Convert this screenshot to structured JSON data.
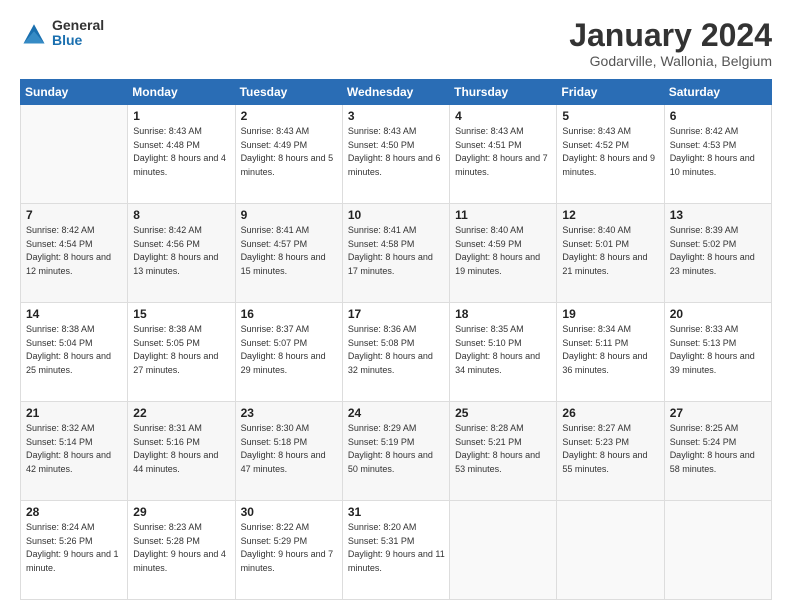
{
  "logo": {
    "general": "General",
    "blue": "Blue"
  },
  "header": {
    "month": "January 2024",
    "location": "Godarville, Wallonia, Belgium"
  },
  "weekdays": [
    "Sunday",
    "Monday",
    "Tuesday",
    "Wednesday",
    "Thursday",
    "Friday",
    "Saturday"
  ],
  "weeks": [
    [
      {
        "day": "",
        "sunrise": "",
        "sunset": "",
        "daylight": ""
      },
      {
        "day": "1",
        "sunrise": "Sunrise: 8:43 AM",
        "sunset": "Sunset: 4:48 PM",
        "daylight": "Daylight: 8 hours and 4 minutes."
      },
      {
        "day": "2",
        "sunrise": "Sunrise: 8:43 AM",
        "sunset": "Sunset: 4:49 PM",
        "daylight": "Daylight: 8 hours and 5 minutes."
      },
      {
        "day": "3",
        "sunrise": "Sunrise: 8:43 AM",
        "sunset": "Sunset: 4:50 PM",
        "daylight": "Daylight: 8 hours and 6 minutes."
      },
      {
        "day": "4",
        "sunrise": "Sunrise: 8:43 AM",
        "sunset": "Sunset: 4:51 PM",
        "daylight": "Daylight: 8 hours and 7 minutes."
      },
      {
        "day": "5",
        "sunrise": "Sunrise: 8:43 AM",
        "sunset": "Sunset: 4:52 PM",
        "daylight": "Daylight: 8 hours and 9 minutes."
      },
      {
        "day": "6",
        "sunrise": "Sunrise: 8:42 AM",
        "sunset": "Sunset: 4:53 PM",
        "daylight": "Daylight: 8 hours and 10 minutes."
      }
    ],
    [
      {
        "day": "7",
        "sunrise": "Sunrise: 8:42 AM",
        "sunset": "Sunset: 4:54 PM",
        "daylight": "Daylight: 8 hours and 12 minutes."
      },
      {
        "day": "8",
        "sunrise": "Sunrise: 8:42 AM",
        "sunset": "Sunset: 4:56 PM",
        "daylight": "Daylight: 8 hours and 13 minutes."
      },
      {
        "day": "9",
        "sunrise": "Sunrise: 8:41 AM",
        "sunset": "Sunset: 4:57 PM",
        "daylight": "Daylight: 8 hours and 15 minutes."
      },
      {
        "day": "10",
        "sunrise": "Sunrise: 8:41 AM",
        "sunset": "Sunset: 4:58 PM",
        "daylight": "Daylight: 8 hours and 17 minutes."
      },
      {
        "day": "11",
        "sunrise": "Sunrise: 8:40 AM",
        "sunset": "Sunset: 4:59 PM",
        "daylight": "Daylight: 8 hours and 19 minutes."
      },
      {
        "day": "12",
        "sunrise": "Sunrise: 8:40 AM",
        "sunset": "Sunset: 5:01 PM",
        "daylight": "Daylight: 8 hours and 21 minutes."
      },
      {
        "day": "13",
        "sunrise": "Sunrise: 8:39 AM",
        "sunset": "Sunset: 5:02 PM",
        "daylight": "Daylight: 8 hours and 23 minutes."
      }
    ],
    [
      {
        "day": "14",
        "sunrise": "Sunrise: 8:38 AM",
        "sunset": "Sunset: 5:04 PM",
        "daylight": "Daylight: 8 hours and 25 minutes."
      },
      {
        "day": "15",
        "sunrise": "Sunrise: 8:38 AM",
        "sunset": "Sunset: 5:05 PM",
        "daylight": "Daylight: 8 hours and 27 minutes."
      },
      {
        "day": "16",
        "sunrise": "Sunrise: 8:37 AM",
        "sunset": "Sunset: 5:07 PM",
        "daylight": "Daylight: 8 hours and 29 minutes."
      },
      {
        "day": "17",
        "sunrise": "Sunrise: 8:36 AM",
        "sunset": "Sunset: 5:08 PM",
        "daylight": "Daylight: 8 hours and 32 minutes."
      },
      {
        "day": "18",
        "sunrise": "Sunrise: 8:35 AM",
        "sunset": "Sunset: 5:10 PM",
        "daylight": "Daylight: 8 hours and 34 minutes."
      },
      {
        "day": "19",
        "sunrise": "Sunrise: 8:34 AM",
        "sunset": "Sunset: 5:11 PM",
        "daylight": "Daylight: 8 hours and 36 minutes."
      },
      {
        "day": "20",
        "sunrise": "Sunrise: 8:33 AM",
        "sunset": "Sunset: 5:13 PM",
        "daylight": "Daylight: 8 hours and 39 minutes."
      }
    ],
    [
      {
        "day": "21",
        "sunrise": "Sunrise: 8:32 AM",
        "sunset": "Sunset: 5:14 PM",
        "daylight": "Daylight: 8 hours and 42 minutes."
      },
      {
        "day": "22",
        "sunrise": "Sunrise: 8:31 AM",
        "sunset": "Sunset: 5:16 PM",
        "daylight": "Daylight: 8 hours and 44 minutes."
      },
      {
        "day": "23",
        "sunrise": "Sunrise: 8:30 AM",
        "sunset": "Sunset: 5:18 PM",
        "daylight": "Daylight: 8 hours and 47 minutes."
      },
      {
        "day": "24",
        "sunrise": "Sunrise: 8:29 AM",
        "sunset": "Sunset: 5:19 PM",
        "daylight": "Daylight: 8 hours and 50 minutes."
      },
      {
        "day": "25",
        "sunrise": "Sunrise: 8:28 AM",
        "sunset": "Sunset: 5:21 PM",
        "daylight": "Daylight: 8 hours and 53 minutes."
      },
      {
        "day": "26",
        "sunrise": "Sunrise: 8:27 AM",
        "sunset": "Sunset: 5:23 PM",
        "daylight": "Daylight: 8 hours and 55 minutes."
      },
      {
        "day": "27",
        "sunrise": "Sunrise: 8:25 AM",
        "sunset": "Sunset: 5:24 PM",
        "daylight": "Daylight: 8 hours and 58 minutes."
      }
    ],
    [
      {
        "day": "28",
        "sunrise": "Sunrise: 8:24 AM",
        "sunset": "Sunset: 5:26 PM",
        "daylight": "Daylight: 9 hours and 1 minute."
      },
      {
        "day": "29",
        "sunrise": "Sunrise: 8:23 AM",
        "sunset": "Sunset: 5:28 PM",
        "daylight": "Daylight: 9 hours and 4 minutes."
      },
      {
        "day": "30",
        "sunrise": "Sunrise: 8:22 AM",
        "sunset": "Sunset: 5:29 PM",
        "daylight": "Daylight: 9 hours and 7 minutes."
      },
      {
        "day": "31",
        "sunrise": "Sunrise: 8:20 AM",
        "sunset": "Sunset: 5:31 PM",
        "daylight": "Daylight: 9 hours and 11 minutes."
      },
      {
        "day": "",
        "sunrise": "",
        "sunset": "",
        "daylight": ""
      },
      {
        "day": "",
        "sunrise": "",
        "sunset": "",
        "daylight": ""
      },
      {
        "day": "",
        "sunrise": "",
        "sunset": "",
        "daylight": ""
      }
    ]
  ]
}
